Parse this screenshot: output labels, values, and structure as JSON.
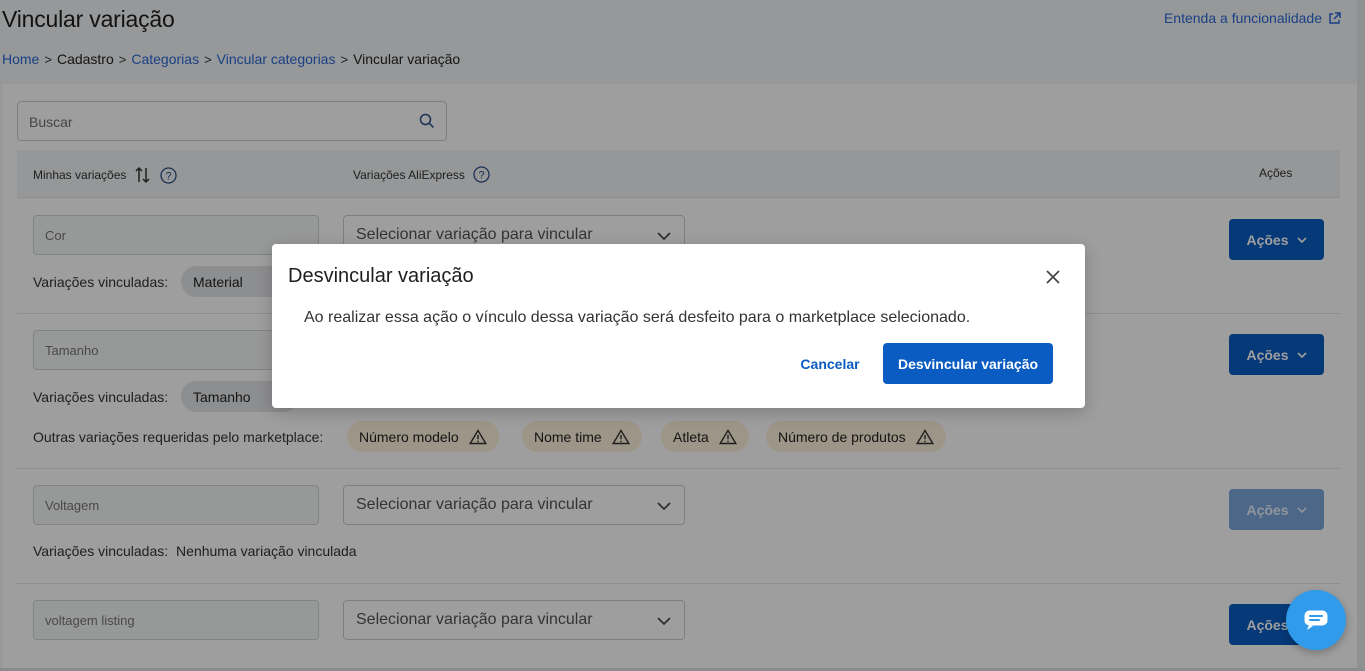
{
  "header": {
    "title": "Vincular variação",
    "help_link": "Entenda a funcionalidade",
    "breadcrumb": [
      "Home",
      "Cadastro",
      "Categorias",
      "Vincular categorias",
      "Vincular variação"
    ]
  },
  "search": {
    "placeholder": "Buscar"
  },
  "table": {
    "col_mine": "Minhas variações",
    "col_ali": "Variações AliExpress",
    "col_actions": "Ações"
  },
  "rows": [
    {
      "name": "Cor",
      "select": "Selecionar variação para vincular",
      "linked_label": "Variações vinculadas:",
      "chip": "Material",
      "actions": "Ações"
    },
    {
      "name": "Tamanho",
      "linked_label": "Variações vinculadas:",
      "chip": "Tamanho",
      "other_label": "Outras variações requeridas pelo marketplace:",
      "required": [
        "Número modelo",
        "Nome time",
        "Atleta",
        "Número de produtos"
      ],
      "actions": "Ações"
    },
    {
      "name": "Voltagem",
      "select": "Selecionar variação para vincular",
      "linked_label": "Variações vinculadas:",
      "linked_value": "Nenhuma variação vinculada",
      "actions": "Ações"
    },
    {
      "name": "voltagem listing",
      "select": "Selecionar variação para vincular",
      "actions": "Ações"
    }
  ],
  "modal": {
    "title": "Desvincular variação",
    "text": "Ao realizar essa ação o vínculo dessa variação será desfeito para o marketplace selecionado.",
    "cancel": "Cancelar",
    "confirm": "Desvincular variação"
  },
  "colors": {
    "primary": "#0a5cc2",
    "link": "#2a6ad8",
    "warn_chip": "#fdf1da",
    "chat": "#2f9bea"
  },
  "icons": [
    "external-link-icon",
    "search-icon",
    "sort-icon",
    "help-icon",
    "chevron-down-icon",
    "close-icon",
    "warning-icon",
    "chat-icon"
  ]
}
